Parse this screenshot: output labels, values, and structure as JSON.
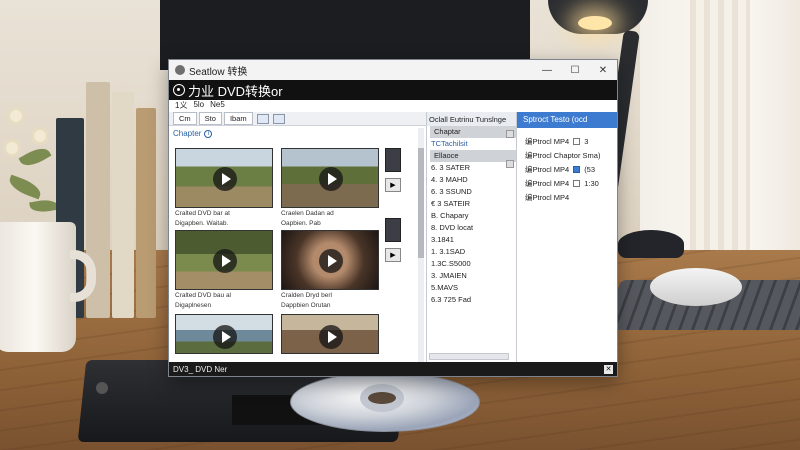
{
  "window": {
    "title": "Seatlow 转换",
    "app_header": "力业 DVD转换or",
    "controls": {
      "minimize": "—",
      "maximize": "☐",
      "close": "✕"
    }
  },
  "menubar": [
    "1义",
    "5lo",
    "Ne5"
  ],
  "tabs": [
    "Cm",
    "Sto",
    "Ibam"
  ],
  "chapter_label": "Chapter",
  "chapters": [
    {
      "caption_line1": "Cralted DVD bar at",
      "caption_line2": "Digapben. Waitab.",
      "scene": "field-road"
    },
    {
      "caption_line1": "Craelen  Dadan ad",
      "caption_line2": "Oapbien. Pab",
      "scene": "farm-people"
    },
    {
      "caption_line1": "Cralted DVD bau al",
      "caption_line2": "Digaplnesen",
      "scene": "tree-path"
    },
    {
      "caption_line1": "Cralden Dryd berl",
      "caption_line2": "Dappbien Orutan",
      "scene": "child-portrait"
    },
    {
      "caption_line1": "",
      "caption_line2": "",
      "scene": "lake"
    },
    {
      "caption_line1": "",
      "caption_line2": "",
      "scene": "people"
    }
  ],
  "middle_pane": {
    "header": "Oclall Eutrinu Tunslnge",
    "rows": [
      {
        "text": "Chaptar",
        "style": "grey"
      },
      {
        "text": "TCTachilsit",
        "style": "blue"
      },
      {
        "text": "Ellaoce",
        "style": "grey"
      },
      {
        "text": "6. 3 SATER",
        "style": ""
      },
      {
        "text": "4. 3 MAHD",
        "style": ""
      },
      {
        "text": "6. 3 SSUND",
        "style": ""
      },
      {
        "text": "€ 3 SATEIR",
        "style": ""
      },
      {
        "text": "B. Chapary",
        "style": ""
      },
      {
        "text": "8. DVD locat",
        "style": ""
      },
      {
        "text": "3.1841",
        "style": ""
      },
      {
        "text": "1. 3.1SAD",
        "style": ""
      },
      {
        "text": "1.3C.S5000",
        "style": ""
      },
      {
        "text": "3. JMAIEN",
        "style": ""
      },
      {
        "text": "5.MAVS",
        "style": ""
      },
      {
        "text": "6.3 725 Fad",
        "style": ""
      }
    ]
  },
  "right_pane": {
    "header": "Sptroct  Testo (ocd",
    "rows": [
      {
        "label": "编Ptrocl  MP4",
        "icon": "doc-icon",
        "value": "3"
      },
      {
        "label": "编Ptrocl  Chaptor Sma)",
        "icon": "",
        "value": ""
      },
      {
        "label": "编Ptrocl  MP4",
        "icon": "blue-square-icon",
        "value": "(53"
      },
      {
        "label": "编Ptrocl  MP4",
        "icon": "checkbox-icon",
        "value": "1:30"
      },
      {
        "label": "编Ptrocl  MP4",
        "icon": "",
        "value": ""
      }
    ]
  },
  "statusbar": {
    "text": "DV3_ DVD Ner",
    "close": "✕"
  }
}
